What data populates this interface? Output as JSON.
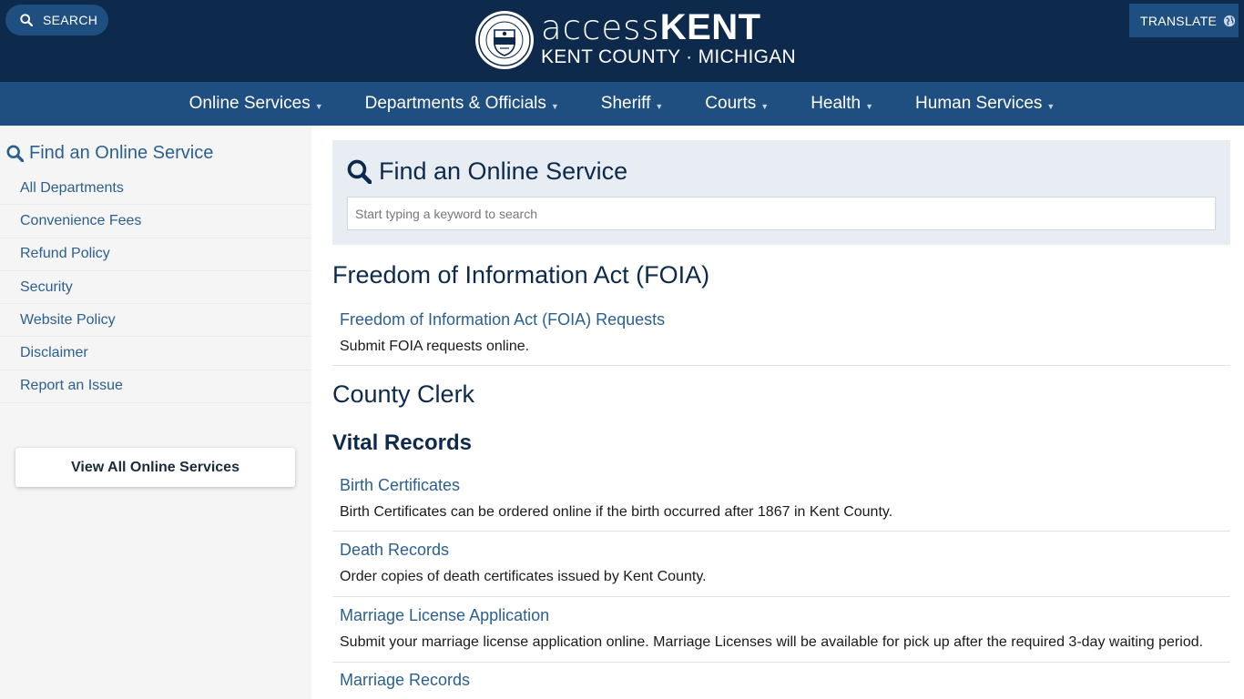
{
  "header": {
    "search_label": "SEARCH",
    "translate_label": "TRANSLATE",
    "logo_light": "access",
    "logo_bold": "KENT",
    "logo_sub": "KENT COUNTY · MICHIGAN"
  },
  "nav": {
    "items": [
      "Online Services",
      "Departments & Officials",
      "Sheriff",
      "Courts",
      "Health",
      "Human Services"
    ]
  },
  "sidebar": {
    "title": "Find an Online Service",
    "items": [
      "All Departments",
      "Convenience Fees",
      "Refund Policy",
      "Security",
      "Website Policy",
      "Disclaimer",
      "Report an Issue"
    ],
    "view_all_label": "View All Online Services"
  },
  "main": {
    "title": "Find an Online Service",
    "search_placeholder": "Start typing a keyword to search",
    "sections": [
      {
        "heading": "Freedom of Information Act (FOIA)",
        "entries": [
          {
            "link": "Freedom of Information Act (FOIA) Requests",
            "desc": "Submit FOIA requests online."
          }
        ]
      },
      {
        "heading": "County Clerk",
        "subheading": "Vital Records",
        "entries": [
          {
            "link": "Birth Certificates",
            "desc": "Birth Certificates can be ordered online if the birth occurred after 1867 in Kent County."
          },
          {
            "link": "Death Records",
            "desc": "Order copies of death certificates issued by Kent County."
          },
          {
            "link": "Marriage License Application",
            "desc": "Submit your marriage license application online. Marriage Licenses will be available for pick up after the required 3-day waiting period."
          },
          {
            "link": "Marriage Records",
            "desc": ""
          }
        ]
      }
    ]
  },
  "colors": {
    "header_bg": "#0d2a4c",
    "nav_bg": "#1f4e80",
    "link": "#2b5f8f",
    "sidebar_bg": "#f5f5f5",
    "panel_bg": "#e8edf3"
  },
  "icons": {
    "search": "search-icon",
    "globe": "globe-icon",
    "seal": "county-seal-icon",
    "caret": "caret-down-icon"
  }
}
